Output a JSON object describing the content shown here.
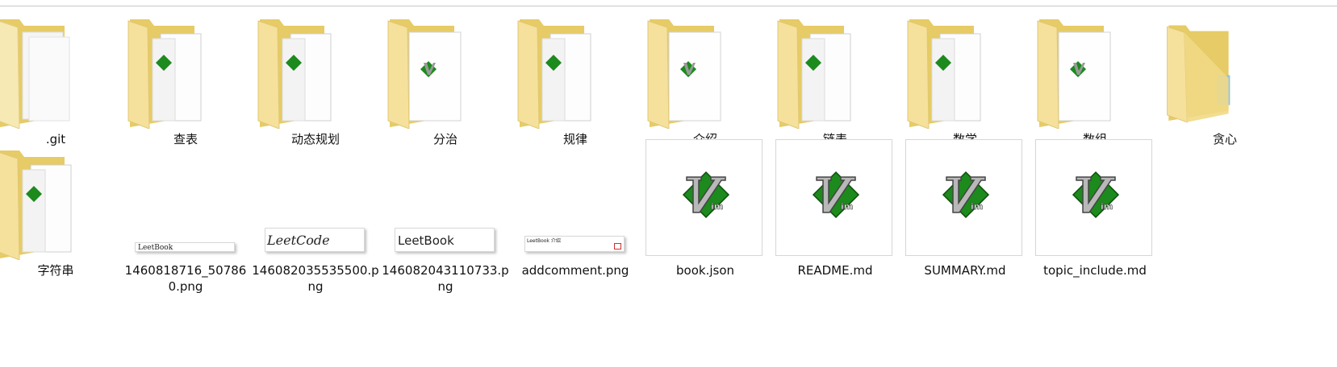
{
  "folders": [
    {
      "name": ".git",
      "variant": "plain"
    },
    {
      "name": "查表",
      "variant": "vim-side"
    },
    {
      "name": "动态规划",
      "variant": "vim-side"
    },
    {
      "name": "分治",
      "variant": "vim-center"
    },
    {
      "name": "规律",
      "variant": "vim-side"
    },
    {
      "name": "介绍",
      "variant": "vim-center"
    },
    {
      "name": "链表",
      "variant": "vim-side"
    },
    {
      "name": "数学",
      "variant": "vim-side"
    },
    {
      "name": "数组",
      "variant": "vim-center"
    },
    {
      "name": "贪心",
      "variant": "cut"
    },
    {
      "name": "字符串",
      "variant": "vim-side"
    }
  ],
  "images": [
    {
      "name": "1460818716_507860.png",
      "thumb_text": "LeetBook"
    },
    {
      "name": "146082035535500.png",
      "thumb_text": "LeetCode"
    },
    {
      "name": "146082043110733.png",
      "thumb_text": "LeetBook"
    },
    {
      "name": "addcomment.png",
      "thumb_text": "LeetBook 介绍"
    }
  ],
  "files": [
    {
      "name": "book.json",
      "icon": "vim-icon"
    },
    {
      "name": "README.md",
      "icon": "vim-icon"
    },
    {
      "name": "SUMMARY.md",
      "icon": "vim-icon"
    },
    {
      "name": "topic_include.md",
      "icon": "vim-icon"
    }
  ],
  "colors": {
    "folder_back": "#e9cf6d",
    "folder_front": "#f6e4a0",
    "vim_green": "#1c8a1c",
    "vim_gray": "#a9a9a9"
  }
}
